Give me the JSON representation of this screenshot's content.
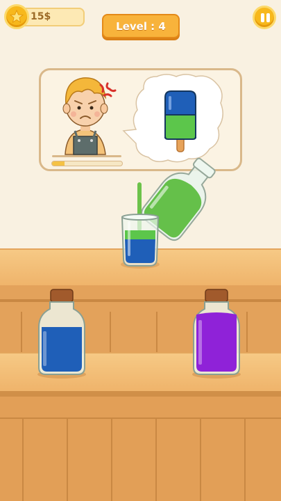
{
  "header": {
    "coins": "15$",
    "level": "Level : 4"
  },
  "order": {
    "progress": 0.18,
    "customer_mood": "angry",
    "popsicle_layers": [
      "blue",
      "green"
    ]
  },
  "colors": {
    "blue_liquid": "#1f5fb8",
    "green_liquid": "#5cc64b",
    "purple_liquid": "#8f22d8",
    "coin_gold": "#f7b81c",
    "level_orange": "#f8b33b"
  },
  "bottles": [
    {
      "name": "blue-sand-bottle",
      "color": "blue"
    },
    {
      "name": "purple-sand-bottle",
      "color": "purple"
    }
  ],
  "icons": {
    "coin": "coin-icon",
    "pause": "pause-icon",
    "angry": "angry-mark-icon"
  }
}
